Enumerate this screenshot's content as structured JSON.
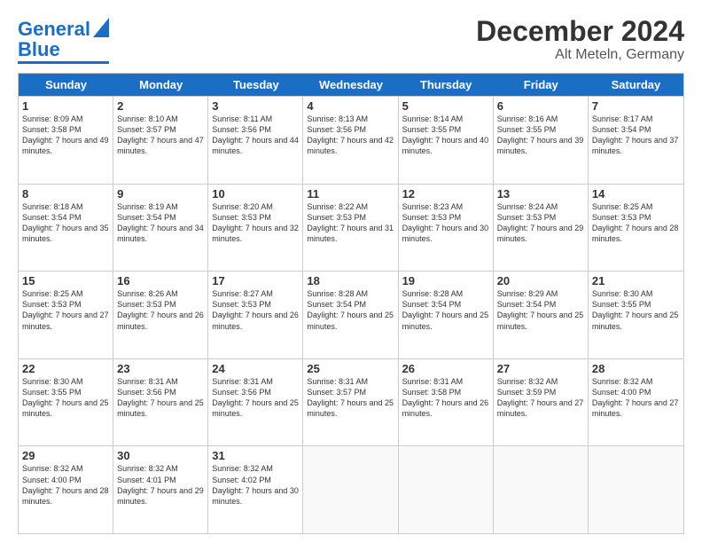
{
  "logo": {
    "line1": "General",
    "line2": "Blue"
  },
  "title": "December 2024",
  "subtitle": "Alt Meteln, Germany",
  "days": [
    "Sunday",
    "Monday",
    "Tuesday",
    "Wednesday",
    "Thursday",
    "Friday",
    "Saturday"
  ],
  "weeks": [
    [
      {
        "day": "1",
        "sunrise": "Sunrise: 8:09 AM",
        "sunset": "Sunset: 3:58 PM",
        "daylight": "Daylight: 7 hours and 49 minutes."
      },
      {
        "day": "2",
        "sunrise": "Sunrise: 8:10 AM",
        "sunset": "Sunset: 3:57 PM",
        "daylight": "Daylight: 7 hours and 47 minutes."
      },
      {
        "day": "3",
        "sunrise": "Sunrise: 8:11 AM",
        "sunset": "Sunset: 3:56 PM",
        "daylight": "Daylight: 7 hours and 44 minutes."
      },
      {
        "day": "4",
        "sunrise": "Sunrise: 8:13 AM",
        "sunset": "Sunset: 3:56 PM",
        "daylight": "Daylight: 7 hours and 42 minutes."
      },
      {
        "day": "5",
        "sunrise": "Sunrise: 8:14 AM",
        "sunset": "Sunset: 3:55 PM",
        "daylight": "Daylight: 7 hours and 40 minutes."
      },
      {
        "day": "6",
        "sunrise": "Sunrise: 8:16 AM",
        "sunset": "Sunset: 3:55 PM",
        "daylight": "Daylight: 7 hours and 39 minutes."
      },
      {
        "day": "7",
        "sunrise": "Sunrise: 8:17 AM",
        "sunset": "Sunset: 3:54 PM",
        "daylight": "Daylight: 7 hours and 37 minutes."
      }
    ],
    [
      {
        "day": "8",
        "sunrise": "Sunrise: 8:18 AM",
        "sunset": "Sunset: 3:54 PM",
        "daylight": "Daylight: 7 hours and 35 minutes."
      },
      {
        "day": "9",
        "sunrise": "Sunrise: 8:19 AM",
        "sunset": "Sunset: 3:54 PM",
        "daylight": "Daylight: 7 hours and 34 minutes."
      },
      {
        "day": "10",
        "sunrise": "Sunrise: 8:20 AM",
        "sunset": "Sunset: 3:53 PM",
        "daylight": "Daylight: 7 hours and 32 minutes."
      },
      {
        "day": "11",
        "sunrise": "Sunrise: 8:22 AM",
        "sunset": "Sunset: 3:53 PM",
        "daylight": "Daylight: 7 hours and 31 minutes."
      },
      {
        "day": "12",
        "sunrise": "Sunrise: 8:23 AM",
        "sunset": "Sunset: 3:53 PM",
        "daylight": "Daylight: 7 hours and 30 minutes."
      },
      {
        "day": "13",
        "sunrise": "Sunrise: 8:24 AM",
        "sunset": "Sunset: 3:53 PM",
        "daylight": "Daylight: 7 hours and 29 minutes."
      },
      {
        "day": "14",
        "sunrise": "Sunrise: 8:25 AM",
        "sunset": "Sunset: 3:53 PM",
        "daylight": "Daylight: 7 hours and 28 minutes."
      }
    ],
    [
      {
        "day": "15",
        "sunrise": "Sunrise: 8:25 AM",
        "sunset": "Sunset: 3:53 PM",
        "daylight": "Daylight: 7 hours and 27 minutes."
      },
      {
        "day": "16",
        "sunrise": "Sunrise: 8:26 AM",
        "sunset": "Sunset: 3:53 PM",
        "daylight": "Daylight: 7 hours and 26 minutes."
      },
      {
        "day": "17",
        "sunrise": "Sunrise: 8:27 AM",
        "sunset": "Sunset: 3:53 PM",
        "daylight": "Daylight: 7 hours and 26 minutes."
      },
      {
        "day": "18",
        "sunrise": "Sunrise: 8:28 AM",
        "sunset": "Sunset: 3:54 PM",
        "daylight": "Daylight: 7 hours and 25 minutes."
      },
      {
        "day": "19",
        "sunrise": "Sunrise: 8:28 AM",
        "sunset": "Sunset: 3:54 PM",
        "daylight": "Daylight: 7 hours and 25 minutes."
      },
      {
        "day": "20",
        "sunrise": "Sunrise: 8:29 AM",
        "sunset": "Sunset: 3:54 PM",
        "daylight": "Daylight: 7 hours and 25 minutes."
      },
      {
        "day": "21",
        "sunrise": "Sunrise: 8:30 AM",
        "sunset": "Sunset: 3:55 PM",
        "daylight": "Daylight: 7 hours and 25 minutes."
      }
    ],
    [
      {
        "day": "22",
        "sunrise": "Sunrise: 8:30 AM",
        "sunset": "Sunset: 3:55 PM",
        "daylight": "Daylight: 7 hours and 25 minutes."
      },
      {
        "day": "23",
        "sunrise": "Sunrise: 8:31 AM",
        "sunset": "Sunset: 3:56 PM",
        "daylight": "Daylight: 7 hours and 25 minutes."
      },
      {
        "day": "24",
        "sunrise": "Sunrise: 8:31 AM",
        "sunset": "Sunset: 3:56 PM",
        "daylight": "Daylight: 7 hours and 25 minutes."
      },
      {
        "day": "25",
        "sunrise": "Sunrise: 8:31 AM",
        "sunset": "Sunset: 3:57 PM",
        "daylight": "Daylight: 7 hours and 25 minutes."
      },
      {
        "day": "26",
        "sunrise": "Sunrise: 8:31 AM",
        "sunset": "Sunset: 3:58 PM",
        "daylight": "Daylight: 7 hours and 26 minutes."
      },
      {
        "day": "27",
        "sunrise": "Sunrise: 8:32 AM",
        "sunset": "Sunset: 3:59 PM",
        "daylight": "Daylight: 7 hours and 27 minutes."
      },
      {
        "day": "28",
        "sunrise": "Sunrise: 8:32 AM",
        "sunset": "Sunset: 4:00 PM",
        "daylight": "Daylight: 7 hours and 27 minutes."
      }
    ],
    [
      {
        "day": "29",
        "sunrise": "Sunrise: 8:32 AM",
        "sunset": "Sunset: 4:00 PM",
        "daylight": "Daylight: 7 hours and 28 minutes."
      },
      {
        "day": "30",
        "sunrise": "Sunrise: 8:32 AM",
        "sunset": "Sunset: 4:01 PM",
        "daylight": "Daylight: 7 hours and 29 minutes."
      },
      {
        "day": "31",
        "sunrise": "Sunrise: 8:32 AM",
        "sunset": "Sunset: 4:02 PM",
        "daylight": "Daylight: 7 hours and 30 minutes."
      },
      null,
      null,
      null,
      null
    ]
  ]
}
